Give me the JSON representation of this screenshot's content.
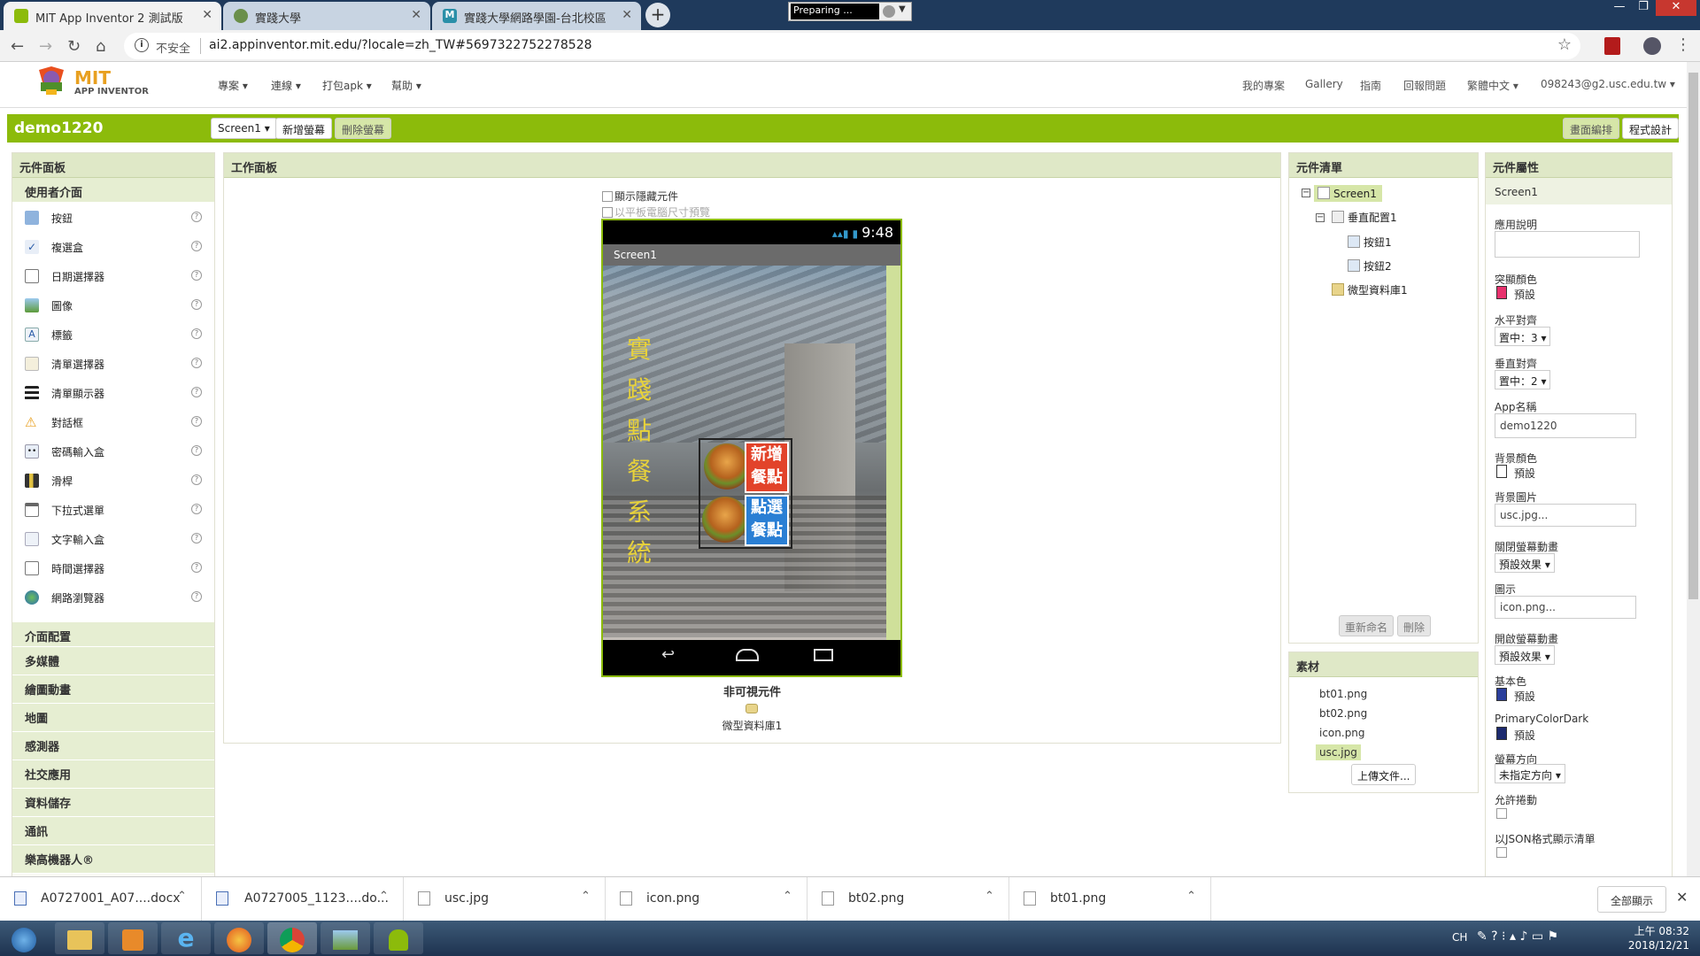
{
  "browser": {
    "tabs": [
      {
        "title": "MIT App Inventor 2 測試版"
      },
      {
        "title": "實踐大學"
      },
      {
        "title": "實踐大學網路學園-台北校區"
      }
    ],
    "preparing": "Preparing ...",
    "not_secure": "不安全",
    "url": "ai2.appinventor.mit.edu/?locale=zh_TW#5697322752278528"
  },
  "app": {
    "logo_mit": "MIT",
    "logo_sub": "APP INVENTOR",
    "menus": [
      "專案 ▾",
      "連線 ▾",
      "打包apk ▾",
      "幫助 ▾"
    ],
    "right_menus": [
      "我的專案",
      "Gallery",
      "指南",
      "回報問題",
      "繁體中文 ▾",
      "098243@g2.usc.edu.tw ▾"
    ]
  },
  "toolbar": {
    "project": "demo1220",
    "screen_select": "Screen1 ▾",
    "add_screen": "新增螢幕",
    "remove_screen": "刪除螢幕",
    "designer": "畫面編排",
    "blocks": "程式設計"
  },
  "palette": {
    "title": "元件面板",
    "user_interface": "使用者介面",
    "items": [
      "按鈕",
      "複選盒",
      "日期選擇器",
      "圖像",
      "標籤",
      "清單選擇器",
      "清單顯示器",
      "對話框",
      "密碼輸入盒",
      "滑桿",
      "下拉式選單",
      "文字輸入盒",
      "時間選擇器",
      "網路瀏覽器"
    ],
    "groups": [
      "介面配置",
      "多媒體",
      "繪圖動畫",
      "地圖",
      "感測器",
      "社交應用",
      "資料儲存",
      "通訊",
      "樂高機器人®"
    ]
  },
  "viewer": {
    "title": "工作面板",
    "show_hidden": "顯示隱藏元件",
    "tablet_preview": "以平板電腦尺寸預覽",
    "status_time": "9:48",
    "screen_title": "Screen1",
    "vertical_title": [
      "實",
      "踐",
      "點",
      "餐",
      "系",
      "統"
    ],
    "btn1_text": [
      "新增",
      "餐點"
    ],
    "btn2_text": [
      "點選",
      "餐點"
    ],
    "nonvisible_label": "非可視元件",
    "nonvisible_item": "微型資料庫1"
  },
  "components": {
    "title": "元件清單",
    "tree": [
      "Screen1",
      "垂直配置1",
      "按鈕1",
      "按鈕2",
      "微型資料庫1"
    ],
    "rename": "重新命名",
    "delete": "刪除"
  },
  "media": {
    "title": "素材",
    "files": [
      "bt01.png",
      "bt02.png",
      "icon.png",
      "usc.jpg"
    ],
    "upload": "上傳文件..."
  },
  "properties": {
    "title": "元件屬性",
    "component": "Screen1",
    "about_label": "應用說明",
    "accent_label": "突顯顏色",
    "accent_value": "預設",
    "halign_label": "水平對齊",
    "halign_value": "置中：3 ▾",
    "valign_label": "垂直對齊",
    "valign_value": "置中：2 ▾",
    "appname_label": "App名稱",
    "appname_value": "demo1220",
    "bgcolor_label": "背景顏色",
    "bgcolor_value": "預設",
    "bgimage_label": "背景圖片",
    "bgimage_value": "usc.jpg...",
    "close_anim_label": "關閉螢幕動畫",
    "close_anim_value": "預設效果 ▾",
    "icon_label": "圖示",
    "icon_value": "icon.png...",
    "open_anim_label": "開啟螢幕動畫",
    "open_anim_value": "預設效果 ▾",
    "primary_label": "基本色",
    "primary_value": "預設",
    "primary_dark_label": "PrimaryColorDark",
    "primary_dark_value": "預設",
    "orientation_label": "螢幕方向",
    "orientation_value": "未指定方向 ▾",
    "scrollable_label": "允許捲動",
    "json_label": "以JSON格式顯示清單",
    "colors": {
      "accent": "#e8326e",
      "bg": "#ffffff",
      "primary": "#2b3f9c",
      "primary_dark": "#1c2a6e"
    }
  },
  "downloads": {
    "items": [
      "A0727001_A07....docx",
      "A0727005_1123....do...",
      "usc.jpg",
      "icon.png",
      "bt02.png",
      "bt01.png"
    ],
    "show_all": "全部顯示"
  },
  "taskbar": {
    "lang": "CH",
    "time": "上午 08:32",
    "date": "2018/12/21"
  },
  "colors": {
    "green": "#8cbb0b",
    "panel_header": "#dfe8c7"
  }
}
